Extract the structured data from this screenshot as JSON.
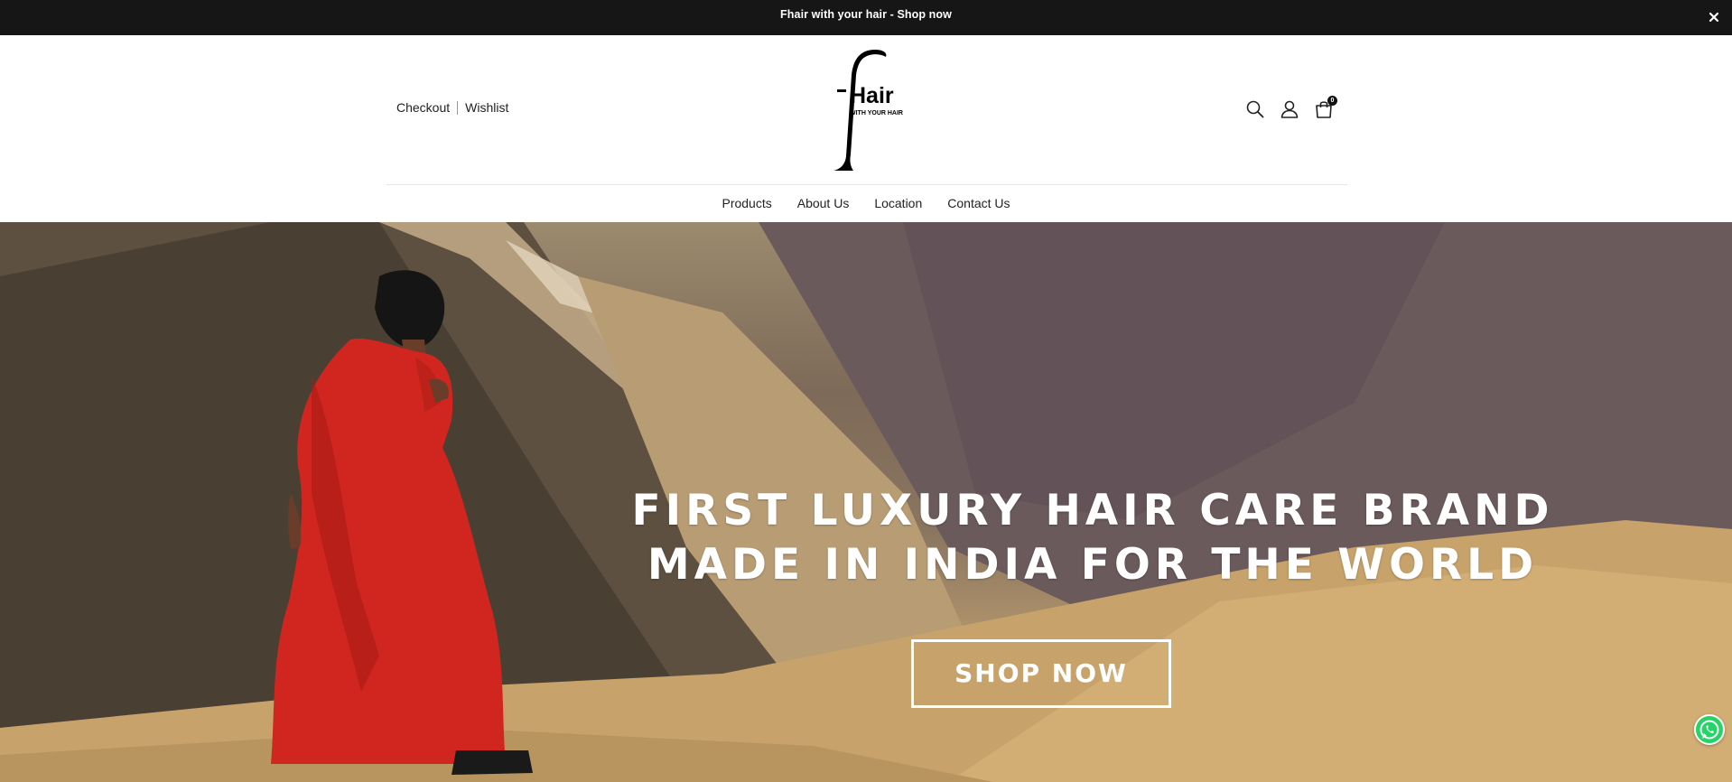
{
  "announcement": {
    "text": "Fhair with your hair - Shop now",
    "close_icon": "close-icon"
  },
  "header": {
    "util_links": [
      "Checkout",
      "Wishlist"
    ],
    "logo": {
      "wordmark": "Hair",
      "initial": "f",
      "tagline": "WITH YOUR HAIR"
    },
    "icons": [
      "search-icon",
      "account-icon",
      "cart-icon"
    ],
    "cart_count": "0"
  },
  "nav": {
    "items": [
      "Products",
      "About Us",
      "Location",
      "Contact Us"
    ]
  },
  "hero": {
    "title_line1": "FIRST LUXURY HAIR CARE BRAND",
    "title_line2": "MADE IN INDIA FOR THE WORLD",
    "cta_label": "SHOP NOW"
  },
  "floating": {
    "whatsapp_icon": "whatsapp-icon"
  },
  "colors": {
    "announce_bg": "#161616",
    "whatsapp": "#25d366",
    "dress": "#d1261f"
  }
}
